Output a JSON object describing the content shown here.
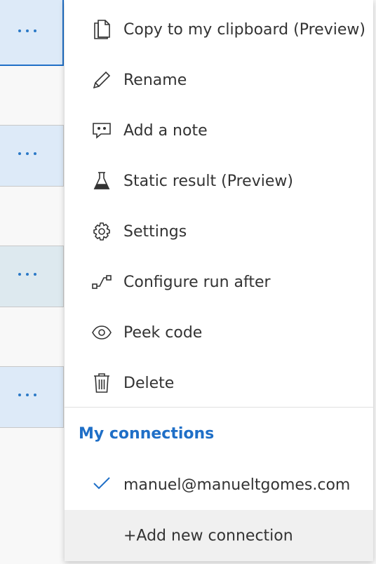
{
  "menu": {
    "items": [
      {
        "label": "Copy to my clipboard (Preview)",
        "icon": "copy-icon"
      },
      {
        "label": "Rename",
        "icon": "pencil-icon"
      },
      {
        "label": "Add a note",
        "icon": "comment-icon"
      },
      {
        "label": "Static result (Preview)",
        "icon": "flask-icon"
      },
      {
        "label": "Settings",
        "icon": "gear-icon"
      },
      {
        "label": "Configure run after",
        "icon": "run-after-icon"
      },
      {
        "label": "Peek code",
        "icon": "eye-icon"
      },
      {
        "label": "Delete",
        "icon": "trash-icon"
      }
    ],
    "connections_title": "My connections",
    "connection": "manuel@manueltgomes.com",
    "add_connection": "+Add new connection"
  },
  "colors": {
    "accent": "#1f6fc7",
    "card": "#ddeaf8",
    "text": "#333333"
  }
}
